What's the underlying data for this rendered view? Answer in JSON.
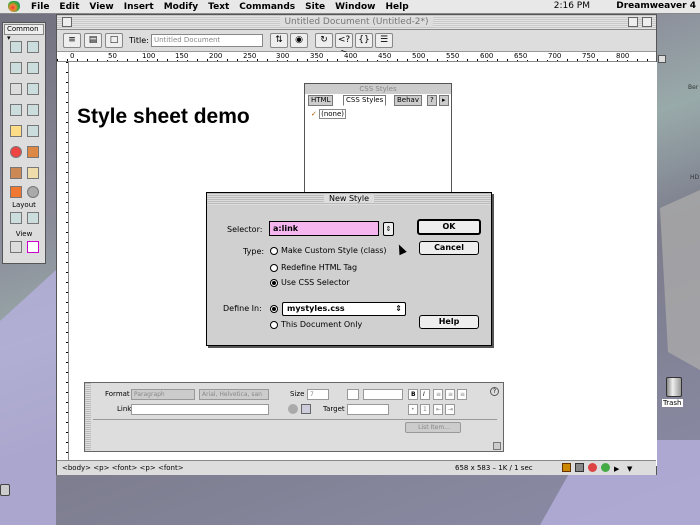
{
  "menubar": {
    "items": [
      "File",
      "Edit",
      "View",
      "Insert",
      "Modify",
      "Text",
      "Commands",
      "Site",
      "Window",
      "Help"
    ],
    "clock": "2:16 PM",
    "app_name": "Dreamweaver 4"
  },
  "document": {
    "window_title": "Untitled Document (Untitled-2*)",
    "title_label": "Title:",
    "title_value": "Untitled Document",
    "heading": "Style sheet demo",
    "status_tags": "<body> <p> <font> <p> <font>",
    "status_size": "658 x 583 – 1K / 1 sec",
    "ruler_marks": [
      "0",
      "50",
      "100",
      "150",
      "200",
      "250",
      "300",
      "350",
      "400",
      "450",
      "500",
      "550",
      "600",
      "650",
      "700",
      "750",
      "800"
    ]
  },
  "objects_palette": {
    "category": "Common",
    "layout_label": "Layout",
    "view_label": "View"
  },
  "css_panel": {
    "title": "CSS Styles",
    "tabs": [
      "HTML",
      "CSS Styles",
      "Behav"
    ],
    "entry": "(none)"
  },
  "dialog": {
    "title": "New Style",
    "selector_label": "Selector:",
    "selector_value": "a:link",
    "type_label": "Type:",
    "type_options": [
      "Make Custom Style (class)",
      "Redefine HTML Tag",
      "Use CSS Selector"
    ],
    "type_selected": 2,
    "define_label": "Define In:",
    "define_file": "mystyles.css",
    "define_doc": "This Document Only",
    "ok_label": "OK",
    "cancel_label": "Cancel",
    "help_label": "Help"
  },
  "properties": {
    "format_label": "Format",
    "format_value": "Paragraph",
    "font_value": "Arial, Helvetica, san",
    "size_label": "Size",
    "size_value": "7",
    "link_label": "Link",
    "target_label": "Target",
    "list_item_label": "List Item..."
  },
  "desktop": {
    "trash_label": "Trash"
  }
}
